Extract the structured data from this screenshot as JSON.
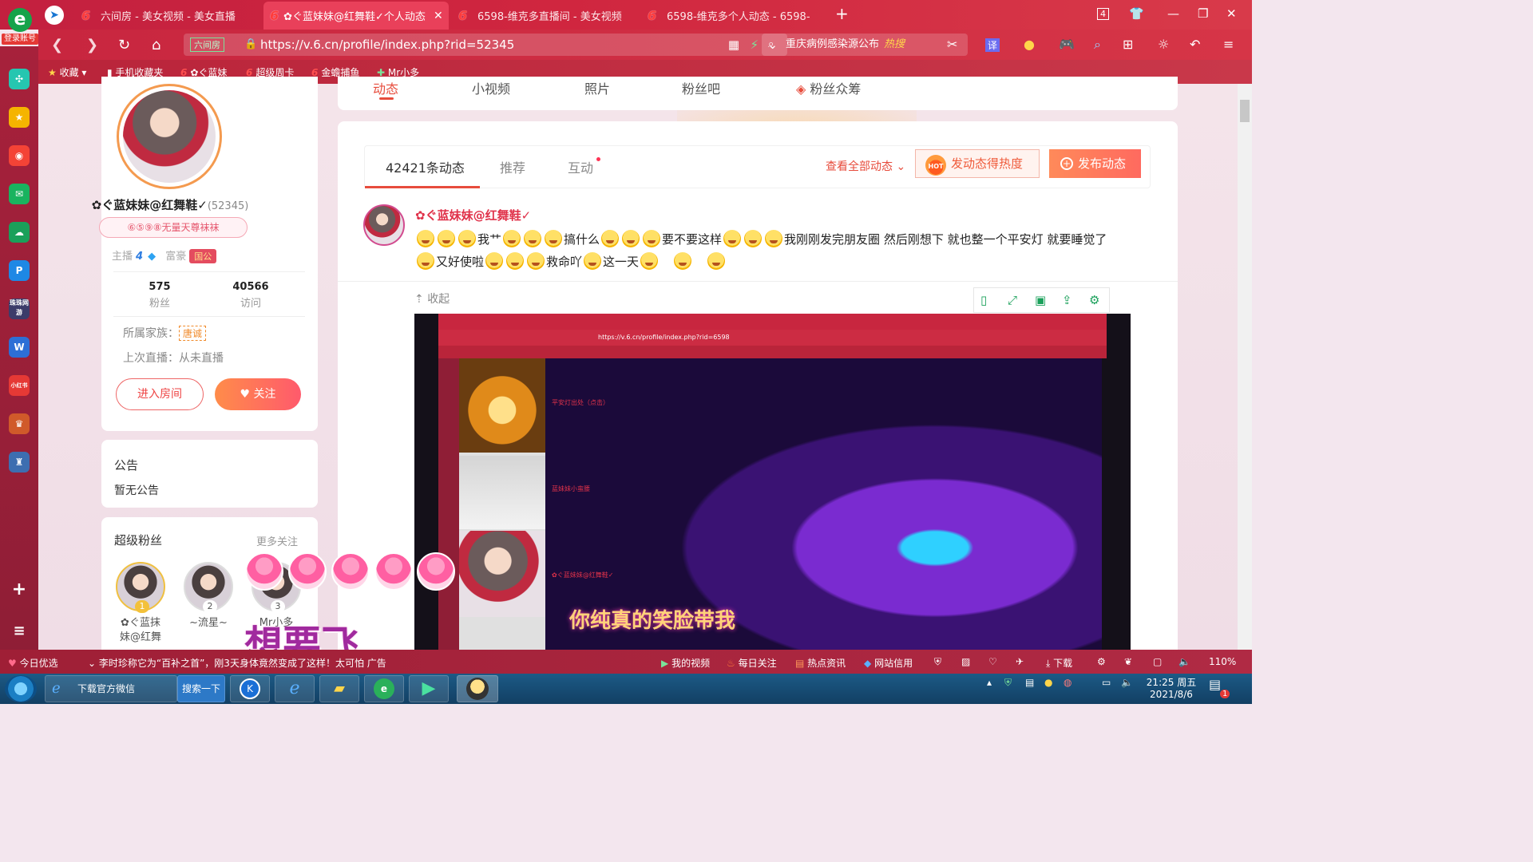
{
  "browser": {
    "login_label": "登录账号",
    "tabs": [
      {
        "label": "六间房 - 美女视频 - 美女直播"
      },
      {
        "label": "✿ぐ蓝妹妹@红舞鞋✓个人动态"
      },
      {
        "label": "6598-维克多直播间 - 美女视频"
      },
      {
        "label": "6598-维克多个人动态 - 6598-"
      }
    ],
    "tab_count": "4",
    "url": "https://v.6.cn/profile/index.php?rid=52345",
    "site_badge": "六间房",
    "search_text": "重庆病例感染源公布",
    "search_hot": "热搜",
    "translate_label": "译"
  },
  "bookmarks": [
    {
      "label": "收藏"
    },
    {
      "label": "手机收藏夹"
    },
    {
      "label": "✿ぐ蓝妹"
    },
    {
      "label": "超级周卡"
    },
    {
      "label": "金蟾捕鱼"
    },
    {
      "label": "Mr小多"
    }
  ],
  "sidebar": {
    "items": [
      "swirl",
      "star",
      "weibo",
      "mail",
      "cloud",
      "p",
      "wanmei",
      "doc",
      "xiaohongshu",
      "game1",
      "game2"
    ],
    "wanmei_label": "珠珠网游",
    "xiaohongshu_label": "小红书"
  },
  "profile": {
    "name": "✿ぐ蓝妹妹@红舞鞋✓",
    "rid": "(52345)",
    "title_badge": "⑥⑤⑨⑧无量天尊袜袜",
    "anchor_label": "主播",
    "anchor_level": "4",
    "rich_label": "富豪",
    "rich_badge": "国公",
    "fans_count": "575",
    "fans_label": "粉丝",
    "visits_count": "40566",
    "visits_label": "访问",
    "family_label": "所属家族：",
    "family_tag": "唐诚",
    "last_live": "上次直播：从未直播",
    "enter_room": "进入房间",
    "follow": "关注"
  },
  "announcement": {
    "title": "公告",
    "content": "暂无公告"
  },
  "super_fans": {
    "title": "超级粉丝",
    "more": "更多关注",
    "fans": [
      {
        "rank": "1",
        "name_line1": "✿ぐ蓝抹",
        "name_line2": "妹@红舞"
      },
      {
        "rank": "2",
        "name_line1": "~流星~",
        "name_line2": ""
      },
      {
        "rank": "3",
        "name_line1": "Mr小多",
        "name_line2": ""
      }
    ]
  },
  "top_nav": {
    "items": [
      "动态",
      "小视频",
      "照片",
      "粉丝吧",
      "粉丝众筹"
    ]
  },
  "feed": {
    "tabs": [
      {
        "label": "42421条动态"
      },
      {
        "label": "推荐"
      },
      {
        "label": "互动"
      }
    ],
    "view_all": "查看全部动态",
    "hot_button": "发动态得热度",
    "hot_icon_text": "HOT",
    "post_button": "发布动态"
  },
  "post": {
    "user": "✿ぐ蓝妹妹@红舞鞋✓",
    "text_1": "我艹",
    "text_2": "搞什么",
    "text_3": "要不要这样",
    "text_4": "我刚刚发完朋友圈 然后刚想下 就也整一个平安灯 就要睡觉了",
    "text_5": "又好使啦",
    "text_6": "救命吖",
    "text_7": "这一天",
    "collapse": "收起"
  },
  "embed": {
    "url": "https://v.6.cn/profile/index.php?rid=6598",
    "label_1": "平安灯出处（点击）",
    "label_2": "蓝妹妹小蛮腰",
    "label_3": "✿ぐ蓝妹妹@红舞鞋✓",
    "lyric": "你纯真的笑脸带我"
  },
  "overlay": {
    "fly_text": "想要飞"
  },
  "statusbar": {
    "today": "今日优选",
    "news": "李时珍称它为“百补之首”，刚3天身体竟然变成了这样！太可怕",
    "ad": "广告",
    "my_video": "我的视频",
    "daily": "每日关注",
    "hot_news": "热点资讯",
    "credit": "网站信用",
    "download": "下载",
    "zoom": "110%"
  },
  "taskbar": {
    "wechat": "下载官方微信",
    "search": "搜索一下",
    "time": "21:25 周五",
    "date": "2021/8/6",
    "notify_count": "1"
  }
}
